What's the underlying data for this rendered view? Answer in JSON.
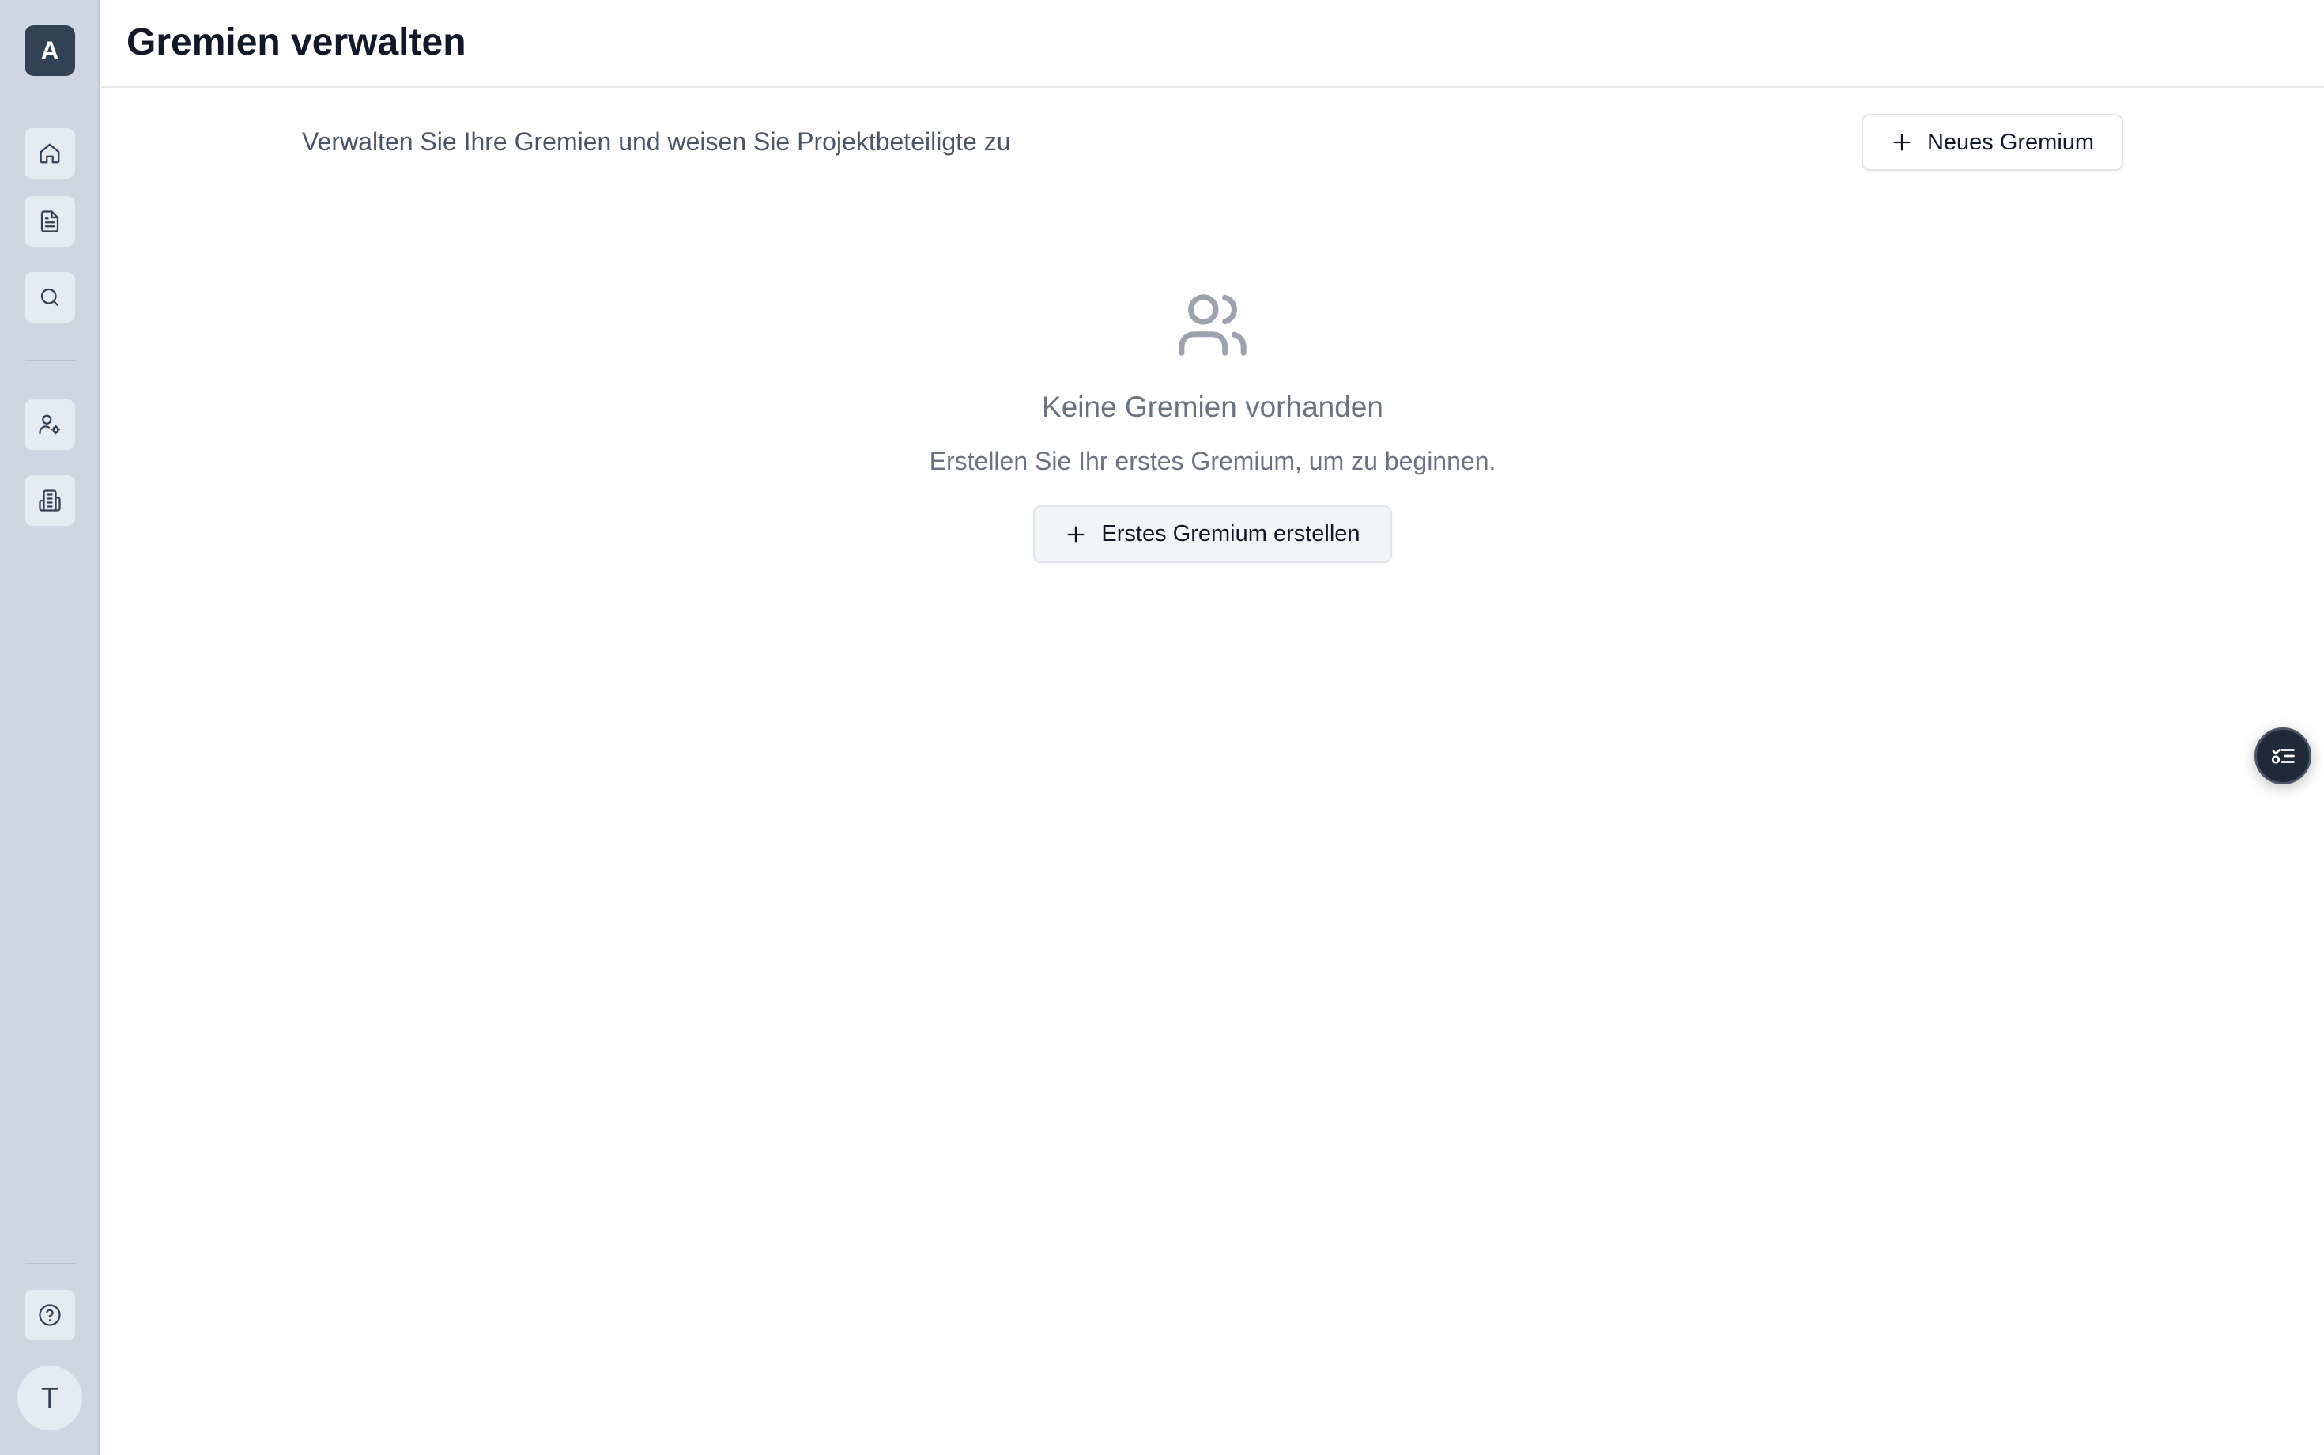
{
  "sidebar": {
    "logo_letter": "A",
    "nav": [
      {
        "icon": "home-icon"
      },
      {
        "icon": "document-icon"
      },
      {
        "icon": "search-icon"
      },
      {
        "icon": "user-settings-icon"
      },
      {
        "icon": "building-icon"
      }
    ],
    "help_icon": "help-circle-icon",
    "avatar_letter": "T"
  },
  "header": {
    "title": "Gremien verwalten"
  },
  "main": {
    "subtitle": "Verwalten Sie Ihre Gremien und weisen Sie Projektbeteiligte zu",
    "new_button_label": "Neues Gremium",
    "empty_state": {
      "icon": "users-icon",
      "title": "Keine Gremien vorhanden",
      "description": "Erstellen Sie Ihr erstes Gremium, um zu beginnen.",
      "button_label": "Erstes Gremium erstellen"
    }
  },
  "floating_button": {
    "icon": "task-list-icon"
  },
  "colors": {
    "sidebar_bg": "#cfd6e1",
    "logo_bg": "#334155",
    "accent_dark": "#1f2937"
  }
}
